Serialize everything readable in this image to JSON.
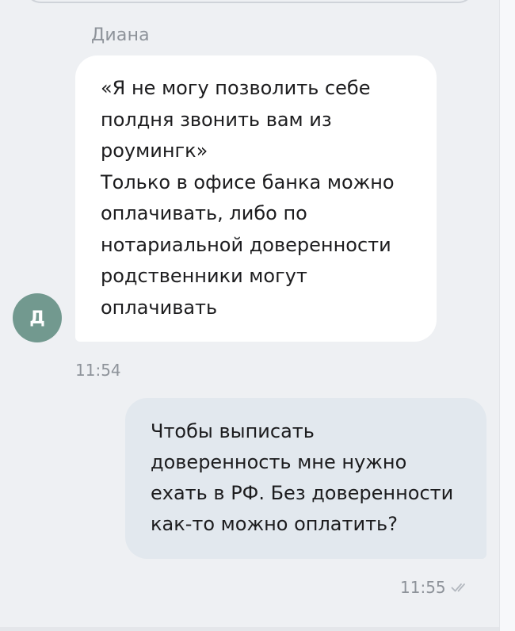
{
  "incoming": {
    "sender_name": "Диана",
    "avatar_initial": "Д",
    "text": "«Я не могу позволить себе\nполдня звонить вам из\nроумингк»\nТолько в офисе банка можно\nоплачивать, либо по\nнотариальной доверенности\nродственники могут\nоплачивать",
    "time": "11:54"
  },
  "outgoing": {
    "text": "Чтобы выписать\nдоверенность мне нужно\nехать в РФ. Без доверенности\nкак-то можно оплатить?",
    "time": "11:55",
    "status_icon": "double-check-icon"
  },
  "colors": {
    "background": "#eef0f3",
    "incoming_bubble": "#ffffff",
    "outgoing_bubble": "#e2e8ee",
    "avatar": "#72998f",
    "meta_text": "#8e939a"
  }
}
